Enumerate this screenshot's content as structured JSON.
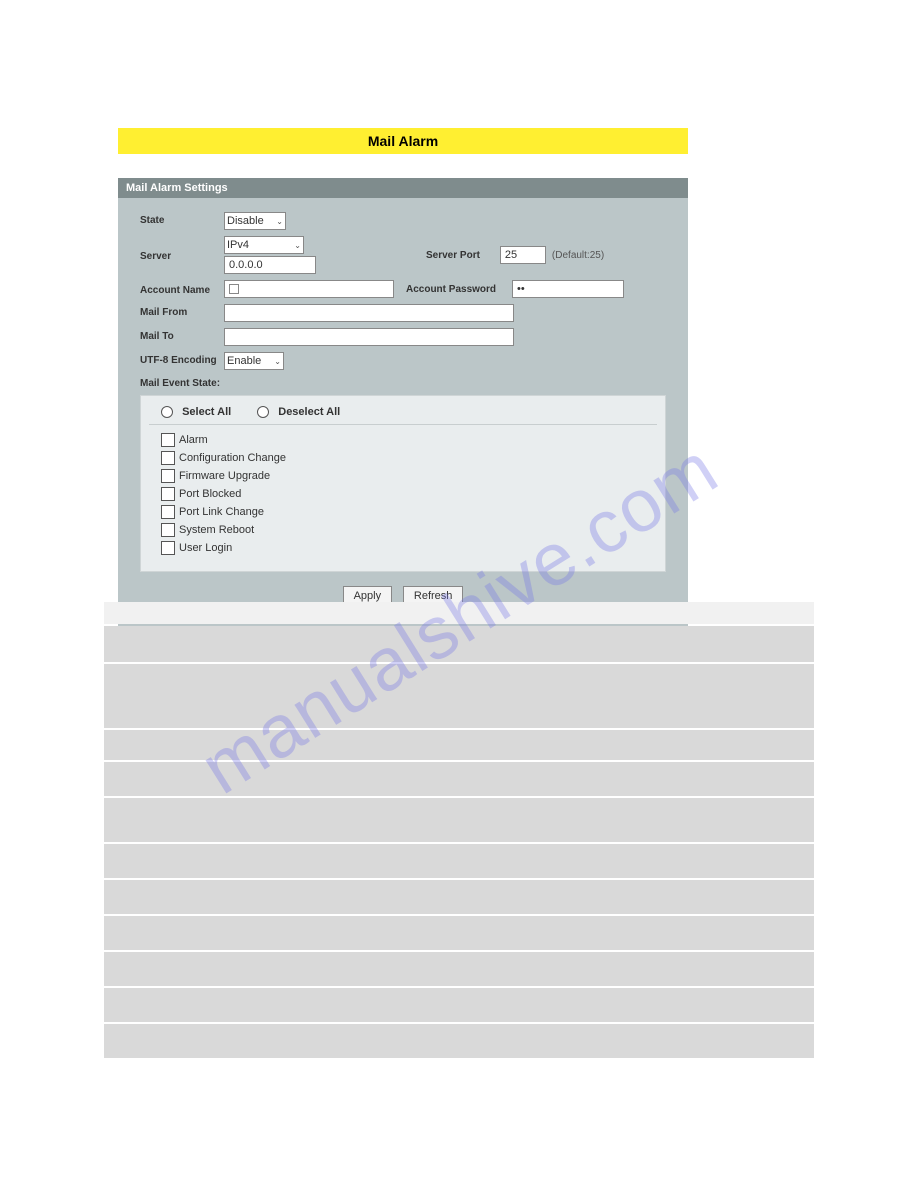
{
  "page": {
    "title": "Mail Alarm",
    "panel_header": "Mail Alarm Settings"
  },
  "labels": {
    "state": "State",
    "server": "Server",
    "server_port": "Server Port",
    "port_hint": "(Default:25)",
    "account_name": "Account Name",
    "account_password": "Account Password",
    "mail_from": "Mail From",
    "mail_to": "Mail To",
    "utf8": "UTF-8 Encoding",
    "event_state": "Mail Event State:",
    "select_all": "Select All",
    "deselect_all": "Deselect All"
  },
  "values": {
    "state": "Disable",
    "ip_type": "IPv4",
    "server_ip": "0.0.0.0",
    "server_port": "25",
    "account_name": "",
    "account_password": "••",
    "mail_from": "",
    "mail_to": "",
    "utf8": "Enable"
  },
  "events": {
    "items": [
      {
        "label": "Alarm"
      },
      {
        "label": "Configuration Change"
      },
      {
        "label": "Firmware Upgrade"
      },
      {
        "label": "Port Blocked"
      },
      {
        "label": "Port Link Change"
      },
      {
        "label": "System Reboot"
      },
      {
        "label": "User Login"
      }
    ]
  },
  "buttons": {
    "apply": "Apply",
    "refresh": "Refresh"
  },
  "table_rows": [
    {
      "h": 22
    },
    {
      "h": 36
    },
    {
      "h": 64
    },
    {
      "h": 30
    },
    {
      "h": 34
    },
    {
      "h": 44
    },
    {
      "h": 34
    },
    {
      "h": 34
    },
    {
      "h": 34
    },
    {
      "h": 34
    },
    {
      "h": 34
    },
    {
      "h": 34
    }
  ],
  "watermark": "manualshive.com"
}
